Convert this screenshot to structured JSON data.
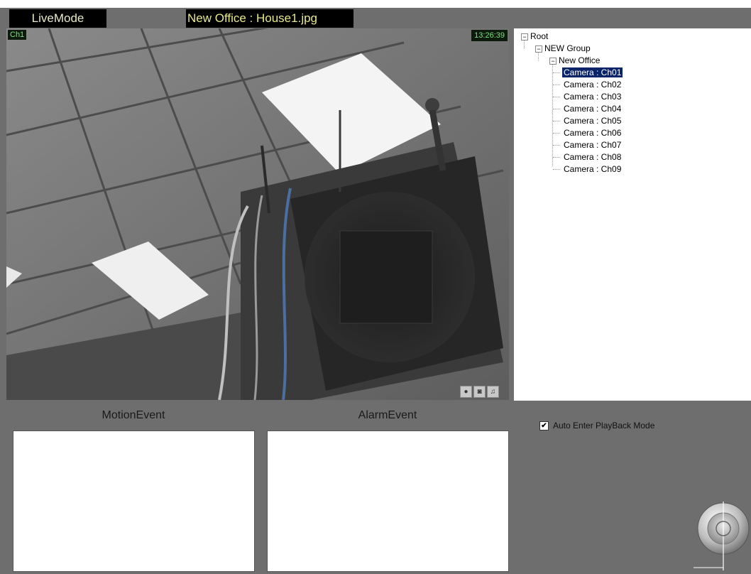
{
  "header": {
    "mode_label": "LiveMode",
    "title": "New Office : House1.jpg"
  },
  "video": {
    "channel": "Ch1",
    "time": "13:26:39",
    "icons": [
      "record-icon",
      "camera-icon",
      "bell-icon"
    ]
  },
  "tree": {
    "root": "Root",
    "group": "NEW Group",
    "office": "New Office",
    "cameras": [
      "Camera : Ch01",
      "Camera : Ch02",
      "Camera : Ch03",
      "Camera : Ch04",
      "Camera : Ch05",
      "Camera : Ch06",
      "Camera : Ch07",
      "Camera : Ch08",
      "Camera : Ch09"
    ],
    "selected_camera": "Camera : Ch01"
  },
  "events": {
    "motion_title": "MotionEvent",
    "alarm_title": "AlarmEvent"
  },
  "options": {
    "auto_playback_label": "Auto Enter PlayBack Mode",
    "auto_playback_checked": true
  },
  "colors": {
    "background": "#6e6e6e",
    "selection": "#0a246a",
    "osd_text": "#7fe07f"
  }
}
